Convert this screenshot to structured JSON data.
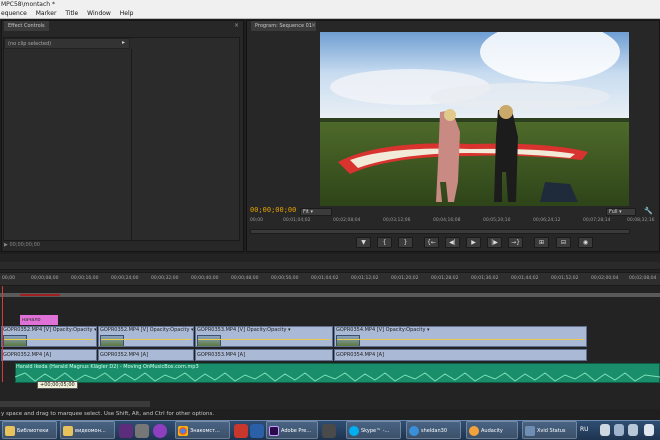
{
  "window": {
    "title": "MPC58\\montach *"
  },
  "menu": [
    "equence",
    "Marker",
    "Title",
    "Window",
    "Help"
  ],
  "effect_controls": {
    "tab": "Effect Controls",
    "close": "×",
    "clip": "(no clip selected)",
    "timecode": "00;00;00;00"
  },
  "program_monitor": {
    "tab": "Program: Sequence 01",
    "close": "×",
    "timecode": "00;00;00;00",
    "fit": "Fit",
    "quality": "Full",
    "ruler": [
      "00;00",
      "00;01;04;02",
      "00;02;08;04",
      "00;03;12;06",
      "00;04;16;08",
      "00;05;20;10",
      "00;06;24;12",
      "00;07;28;14",
      "00;08;32;16"
    ],
    "transport": [
      "▼",
      "{",
      "}",
      "{←",
      "◀|",
      "▶",
      "|▶",
      "→}",
      "⊞",
      "⊟",
      "◉"
    ]
  },
  "timeline": {
    "ruler": [
      "00;00",
      "00;00;08;00",
      "00;00;16;00",
      "00;00;24;00",
      "00;00;32;00",
      "00;00;40;00",
      "00;00;48;00",
      "00;00;56;00",
      "00;01;04;02",
      "00;01;12;02",
      "00;01;20;02",
      "00;01;28;02",
      "00;01;36;02",
      "00;01;44;02",
      "00;01;52;02",
      "00;02;00;04",
      "00;02;08;04"
    ],
    "marker": "начало",
    "video_clips": [
      {
        "label": "GOPR0352.MP4 [V]  Opacity:Opacity ▾"
      },
      {
        "label": "GOPR0352.MP4 [V] Opacity:Opacity ▾"
      },
      {
        "label": "GOPR0353.MP4 [V] Opacity:Opacity ▾"
      },
      {
        "label": "GOPR0354.MP4 [V] Opacity:Opacity ▾"
      }
    ],
    "audio_clips": [
      {
        "label": "GOPR0352.MP4 [A]"
      },
      {
        "label": "GOPR0352.MP4 [A]"
      },
      {
        "label": "GOPR0353.MP4 [A]"
      },
      {
        "label": "GOPR0354.MP4 [A]"
      }
    ],
    "music_label": "Harald Ikeda (Harald Magnus Klägler D2) - Moving OnMusicBox.com.mp3",
    "tooltip": "+00;00;05;00"
  },
  "status_bar": "y space and drag to marquee select. Use Shift, Alt, and Ctrl for other options.",
  "taskbar": {
    "items": [
      "Библиотеки",
      "видеомон...",
      "Знакомст...",
      "Adobe Pre...",
      "Skype™ -...",
      "sheldan30",
      "Audacity",
      "Xvid Status"
    ],
    "lang": "RU"
  },
  "colors": {
    "timecode": "#e6a200",
    "video_clip": "#a9b9d6",
    "music_clip": "#1a8e6a",
    "marker": "#e071d6"
  }
}
